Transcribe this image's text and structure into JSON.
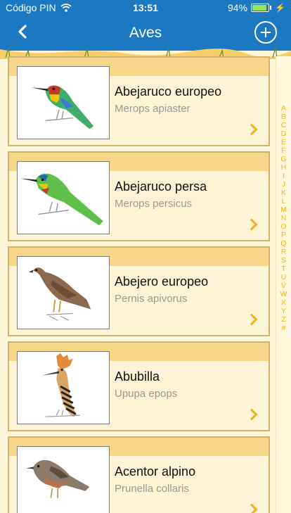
{
  "status": {
    "carrier": "Código PIN",
    "time": "13:51",
    "battery_text": "94%",
    "battery_level": 0.94,
    "bolt": "⚡"
  },
  "nav": {
    "title": "Aves",
    "back_icon": "chevron-left-icon",
    "add_icon": "plus-circle-icon"
  },
  "birds": [
    {
      "name": "Abejaruco europeo",
      "scientific": "Merops apiaster",
      "icon": "bee-eater-illustration"
    },
    {
      "name": "Abejaruco persa",
      "scientific": "Merops persicus",
      "icon": "blue-cheeked-bee-eater-illustration"
    },
    {
      "name": "Abejero europeo",
      "scientific": "Pernis apivorus",
      "icon": "honey-buzzard-illustration"
    },
    {
      "name": "Abubilla",
      "scientific": "Upupa epops",
      "icon": "hoopoe-illustration"
    },
    {
      "name": "Acentor alpino",
      "scientific": "Prunella collaris",
      "icon": "alpine-accentor-illustration"
    }
  ],
  "index_letters": [
    "A",
    "B",
    "C",
    "D",
    "E",
    "F",
    "G",
    "H",
    "I",
    "J",
    "K",
    "L",
    "M",
    "N",
    "O",
    "P",
    "Q",
    "R",
    "S",
    "T",
    "U",
    "V",
    "W",
    "X",
    "Y",
    "Z",
    "#"
  ],
  "colors": {
    "nav_blue": "#1c78c0",
    "accent_yellow": "#f0b41c",
    "card_background": "#fdf3d6",
    "card_band": "#f6d78a"
  }
}
